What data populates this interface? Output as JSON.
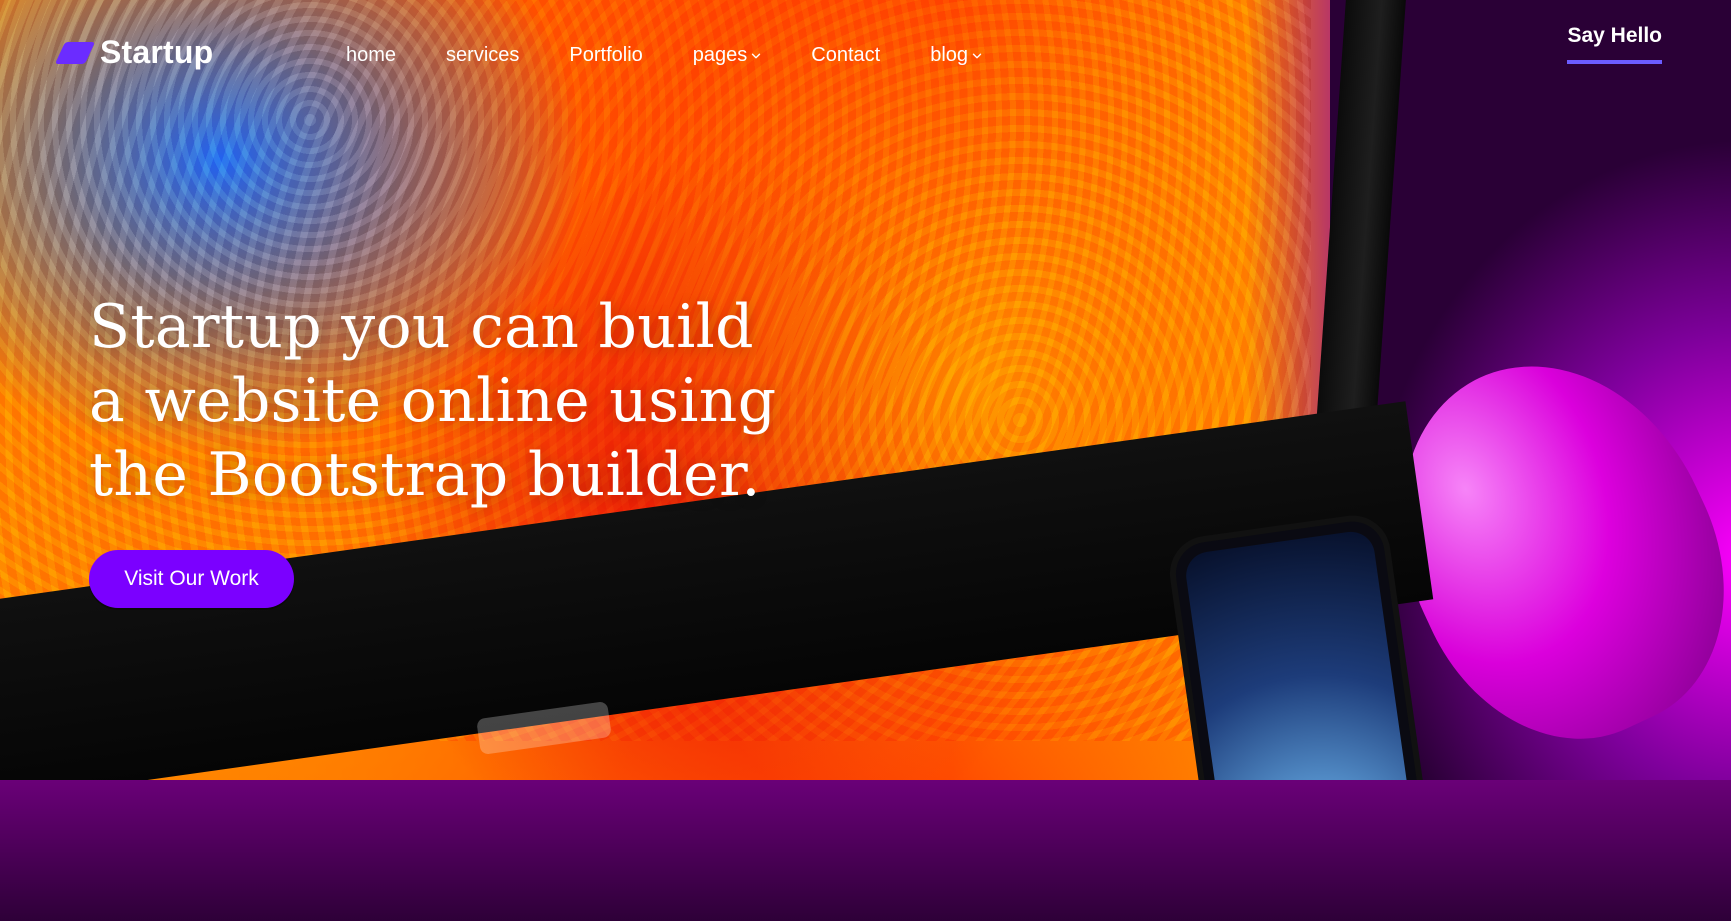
{
  "brand": {
    "name": "Startup",
    "accent_color": "#6b2cff"
  },
  "nav": {
    "items": [
      {
        "label": "home",
        "has_dropdown": false
      },
      {
        "label": "services",
        "has_dropdown": false
      },
      {
        "label": "Portfolio",
        "has_dropdown": false
      },
      {
        "label": "pages",
        "has_dropdown": true
      },
      {
        "label": "Contact",
        "has_dropdown": false
      },
      {
        "label": "blog",
        "has_dropdown": true
      }
    ]
  },
  "header": {
    "cta_label": "Say Hello",
    "cta_underline_color": "#6b5cff"
  },
  "hero": {
    "title": "Startup you can build a website online using the Bootstrap builder.",
    "button_label": "Visit Our Work",
    "button_color": "#7b00ff"
  },
  "icons": {
    "logo_mark": "startup-logo-mark-icon",
    "dropdown": "chevron-down-icon"
  }
}
